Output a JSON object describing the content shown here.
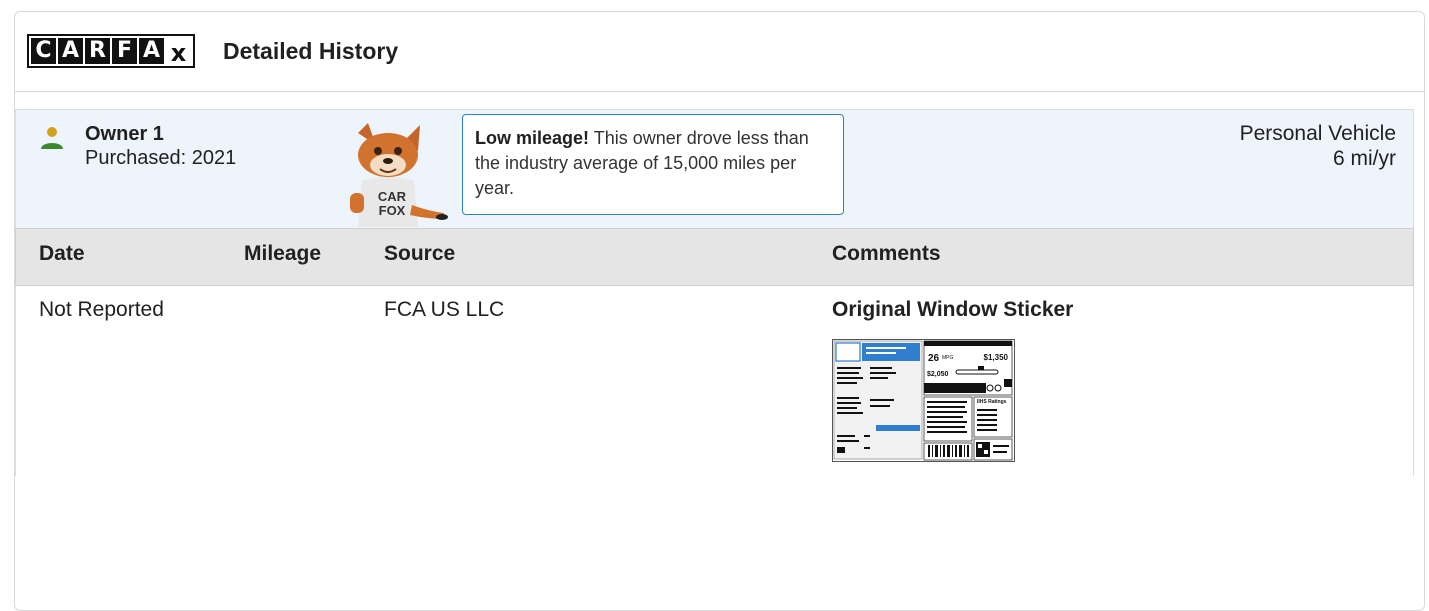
{
  "header": {
    "logo_letters": [
      "C",
      "A",
      "R",
      "F",
      "A",
      "x"
    ],
    "title": "Detailed History"
  },
  "owner": {
    "name": "Owner 1",
    "purchased": "Purchased: 2021",
    "callout_bold": "Low mileage!",
    "callout_text": " This owner drove less than the industry average of 15,000 miles per year.",
    "fox_shirt_text": [
      "CAR",
      "FOX"
    ],
    "vehicle_type": "Personal Vehicle",
    "miles_per_year": "6 mi/yr",
    "icon_color": "#3c8a2e",
    "icon_head_color": "#d4a11e"
  },
  "table": {
    "columns": [
      "Date",
      "Mileage",
      "Source",
      "Comments"
    ],
    "rows": [
      {
        "date": "Not Reported",
        "mileage": "",
        "source": "FCA US LLC",
        "comment_title": "Original Window Sticker"
      }
    ]
  },
  "sticker": {
    "mpg": "26",
    "mpg_unit": "MPG",
    "price_left": "$2,050",
    "price_right": "$1,350",
    "ratings_label": "IIHS Ratings"
  },
  "colors": {
    "accent": "#2f7ed0",
    "owner_bg": "#eef4fb",
    "header_bg": "#e5e5e5"
  }
}
